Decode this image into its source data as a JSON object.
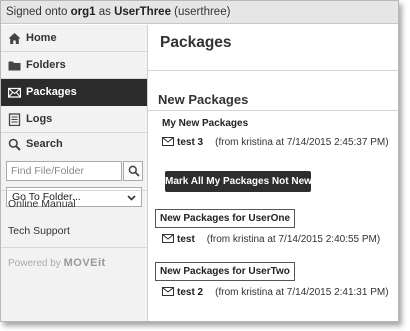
{
  "topbar": {
    "prefix": "Signed onto",
    "org": "org1",
    "as": "as",
    "user": "UserThree",
    "username": "(userthree)"
  },
  "nav": [
    {
      "label": "Home",
      "icon": "home-icon"
    },
    {
      "label": "Folders",
      "icon": "folder-icon"
    },
    {
      "label": "Packages",
      "icon": "envelope-icon",
      "active": true
    },
    {
      "label": "Logs",
      "icon": "log-icon"
    }
  ],
  "search": {
    "label": "Search",
    "placeholder": "Find File/Folder",
    "goto_label": "Go To Folder..."
  },
  "links": {
    "manual": "Online Manual",
    "support": "Tech Support"
  },
  "powered": {
    "prefix": "Powered by",
    "brand": "MOVEit"
  },
  "main": {
    "title": "Packages",
    "section_title": "New Packages",
    "groups": [
      {
        "title": "My New Packages",
        "packages": [
          {
            "name": "test 3",
            "from": "(from kristina at 7/14/2015 2:45:37 PM)"
          }
        ]
      },
      {
        "title": "New Packages for UserOne",
        "packages": [
          {
            "name": "test",
            "from": "(from kristina at 7/14/2015 2:40:55 PM)"
          }
        ]
      },
      {
        "title": "New Packages for UserTwo",
        "packages": [
          {
            "name": "test 2",
            "from": "(from kristina at 7/14/2015 2:41:31 PM)"
          }
        ]
      }
    ],
    "mark_button": "Mark All My Packages Not New"
  }
}
